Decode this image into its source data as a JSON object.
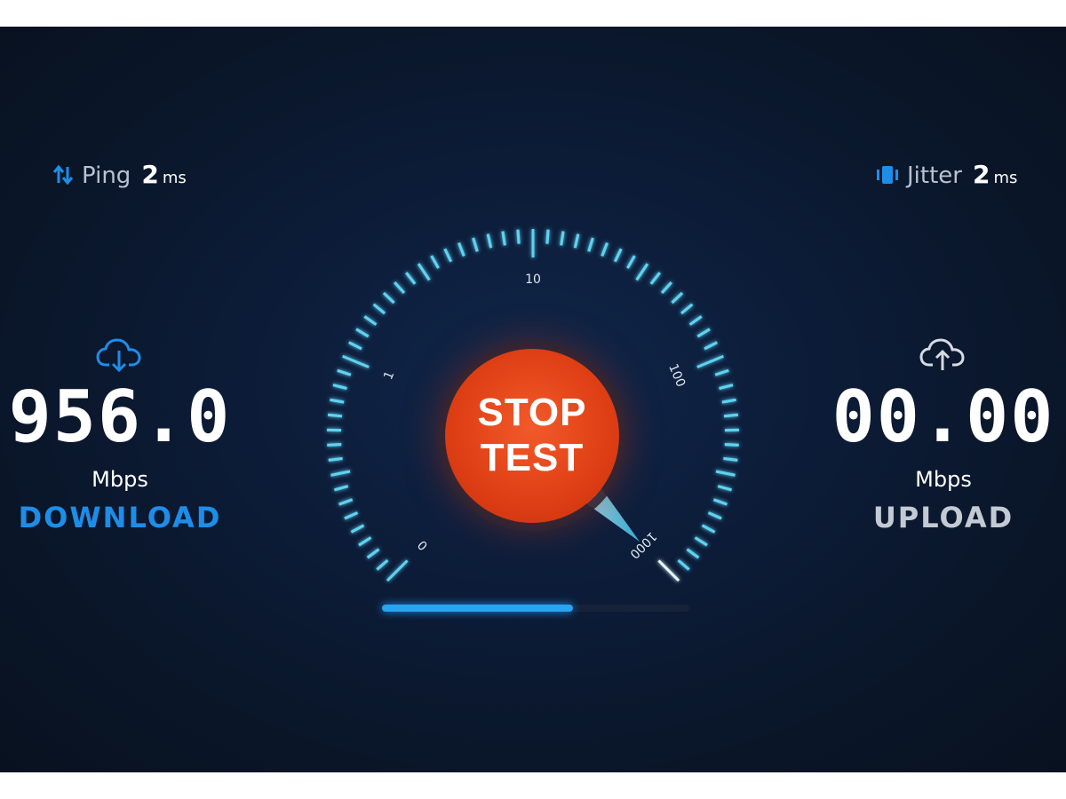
{
  "stats": {
    "ping": {
      "label": "Ping",
      "value": "2",
      "unit": "ms",
      "icon": "ping-arrows-icon"
    },
    "jitter": {
      "label": "Jitter",
      "value": "2",
      "unit": "ms",
      "icon": "jitter-icon"
    }
  },
  "download": {
    "value": "956.0",
    "unit": "Mbps",
    "label": "DOWNLOAD",
    "icon": "cloud-download-icon"
  },
  "upload": {
    "value": "00.00",
    "unit": "Mbps",
    "label": "UPLOAD",
    "icon": "cloud-upload-icon"
  },
  "gauge": {
    "scale_labels": [
      "0",
      "1",
      "10",
      "100",
      "1000"
    ],
    "needle_value": 1000,
    "button_line1": "STOP",
    "button_line2": "TEST"
  },
  "progress": {
    "value": 0.62
  },
  "colors": {
    "accent_blue": "#1e8de8",
    "tick_cyan": "#5fd2f0",
    "button_red": "#de3e14",
    "upload_gray": "#c4cad3"
  }
}
